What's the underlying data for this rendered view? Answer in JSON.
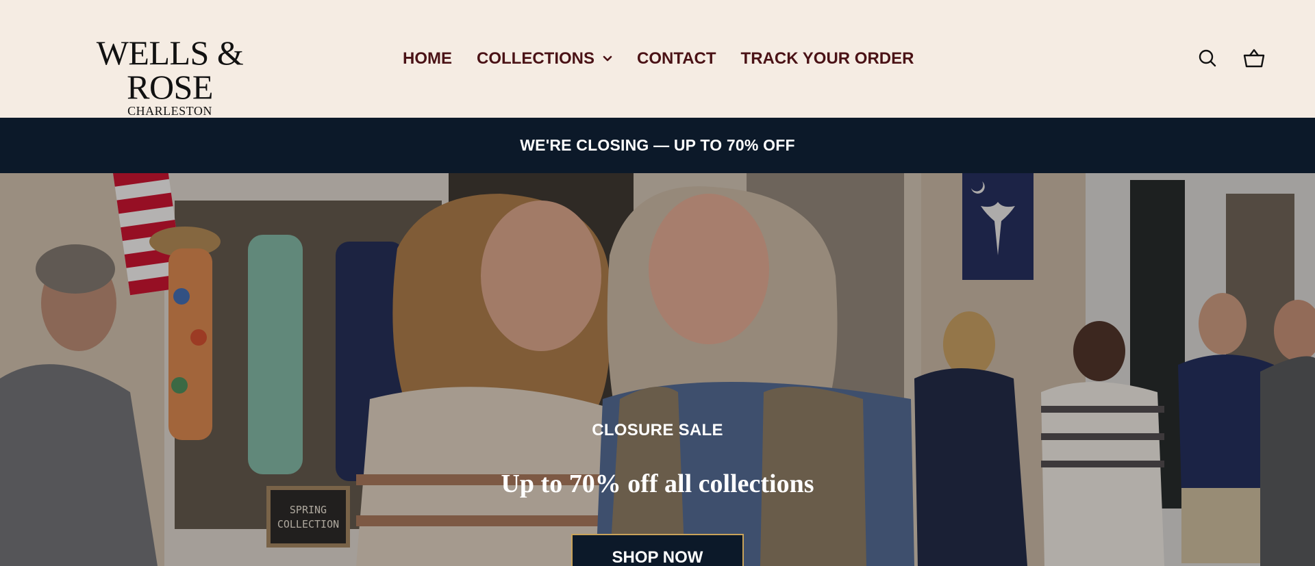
{
  "brand": {
    "name": "WELLS & ROSE",
    "location": "CHARLESTON"
  },
  "nav": {
    "items": [
      {
        "label": "HOME"
      },
      {
        "label": "COLLECTIONS",
        "has_dropdown": true
      },
      {
        "label": "CONTACT"
      },
      {
        "label": "TRACK YOUR ORDER"
      }
    ]
  },
  "header_icons": [
    "search-icon",
    "cart-basket-icon"
  ],
  "announcement": {
    "text": "WE'RE CLOSING — UP TO 70% OFF"
  },
  "hero": {
    "eyebrow": "CLOSURE SALE",
    "title": "Up to 70% off all collections",
    "button_label": "SHOP NOW",
    "storefront_sign": "SPRING COLLECTION"
  },
  "colors": {
    "header_bg": "#f5ece3",
    "nav_text": "#4a1216",
    "announce_bg": "#0c1929",
    "button_bg": "#0c1929",
    "button_border": "#c9a35a"
  }
}
